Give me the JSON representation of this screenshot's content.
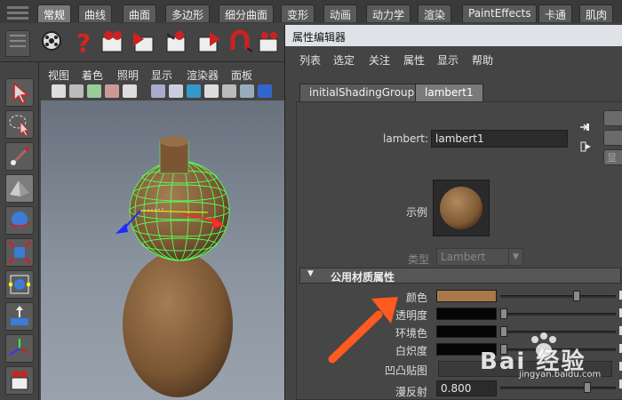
{
  "shelf": {
    "tabs": [
      "常规",
      "曲线",
      "曲面",
      "多边形",
      "细分曲面",
      "变形",
      "动画",
      "动力学",
      "渲染",
      "PaintEffects",
      "卡通",
      "肌肉"
    ],
    "active_tab": "常规"
  },
  "viewport": {
    "menus": [
      "视图",
      "着色",
      "照明",
      "显示",
      "渲染器",
      "面板"
    ]
  },
  "attribute_editor": {
    "title": "属性编辑器",
    "menus": [
      "列表",
      "选定",
      "关注",
      "属性",
      "显示",
      "帮助"
    ],
    "tabs": [
      "initialShadingGroup",
      "lambert1"
    ],
    "active_tab": "lambert1",
    "node_label": "lambert:",
    "node_value": "lambert1",
    "side_button_partial": "显",
    "sample_label": "示例",
    "type_label": "类型",
    "type_value": "Lambert",
    "section_title": "公用材质属性",
    "attrs": [
      {
        "label": "颜色",
        "color": "#a8784a",
        "slider": 0.68
      },
      {
        "label": "透明度",
        "color": "#050505",
        "slider": 0.0
      },
      {
        "label": "环境色",
        "color": "#050505",
        "slider": 0.0
      },
      {
        "label": "白炽度",
        "color": "#050505",
        "slider": 0.0
      }
    ],
    "bump_label": "凹凸贴图",
    "diffuse_label": "漫反射",
    "diffuse_value": "0.800",
    "diffuse_slider": 0.8
  },
  "watermark": {
    "text": "Bai 经验",
    "url": "jingyan.baidu.com"
  },
  "colors": {
    "accent_arrow": "#ff5a1f",
    "material": "#8a6440",
    "wireframe": "#58ff58"
  }
}
